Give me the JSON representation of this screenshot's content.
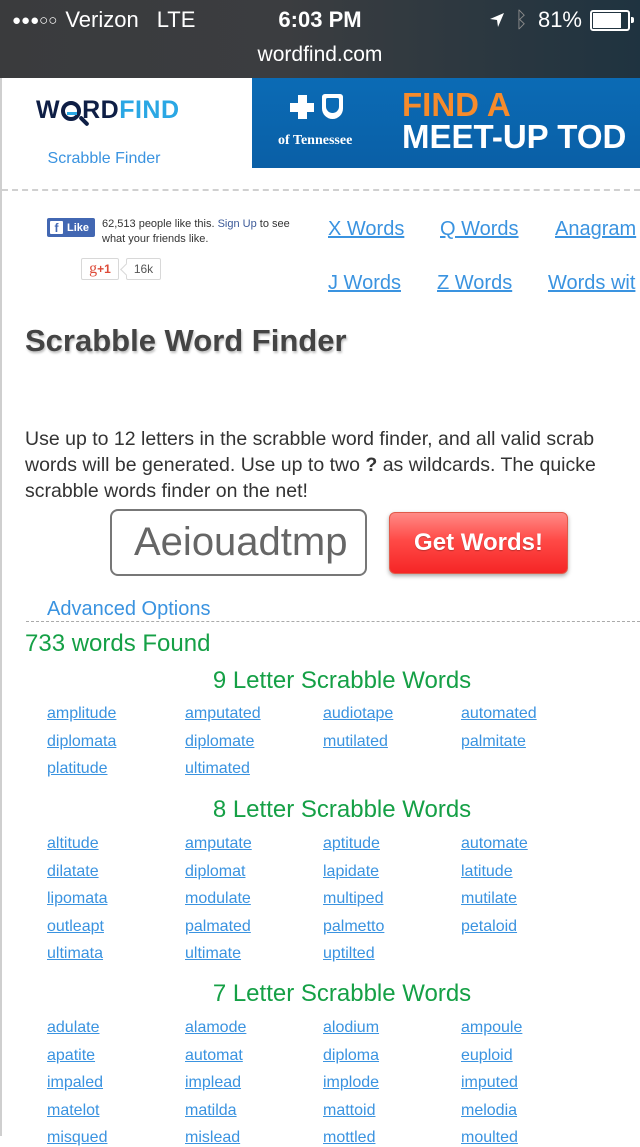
{
  "status_bar": {
    "signal_dots": "●●●○○",
    "carrier": "Verizon",
    "network": "LTE",
    "time": "6:03 PM",
    "battery_percent": "81%",
    "battery_level": 0.81,
    "icons": [
      "location-arrow-icon",
      "bluetooth-icon",
      "battery-icon"
    ]
  },
  "browser": {
    "url": "wordfind.com"
  },
  "header": {
    "logo_dark": "W",
    "logo_dark2": "RD",
    "logo_light": "FIND",
    "tagline": "Scrabble Finder"
  },
  "ad": {
    "sponsor": "of Tennessee",
    "line1": "FIND A",
    "line2": "MEET-UP TOD",
    "colors": {
      "background": "#0b6bb5",
      "accent": "#f68b2b"
    }
  },
  "social": {
    "fb_button": "Like",
    "fb_text_prefix": "62,513 people like this.",
    "fb_signup": "Sign Up",
    "fb_text_suffix": "to see what your friends like.",
    "gplus_label": "+1",
    "gplus_count": "16k"
  },
  "nav_links": [
    {
      "label": "X Words"
    },
    {
      "label": "Q Words"
    },
    {
      "label": "Anagram"
    },
    {
      "label": "J Words"
    },
    {
      "label": "Z Words"
    },
    {
      "label": "Words wit"
    }
  ],
  "main": {
    "title": "Scrabble Word Finder",
    "description_line1": "Use up to 12 letters in the scrabble word finder, and all valid scrab",
    "description_line2_a": "words will be generated. Use up to two",
    "description_wildcard": "?",
    "description_line2_b": "as wildcards. The quicke",
    "description_line3": "scrabble words finder on the net!",
    "letters_value": "Aeiouadtmp",
    "submit_label": "Get Words!",
    "advanced_options": "Advanced Options",
    "found_count": "733 words Found"
  },
  "colors": {
    "link": "#3a93e0",
    "success_green": "#15a046",
    "button_red": "#f52526"
  },
  "results": [
    {
      "title": "9 Letter Scrabble Words",
      "words": [
        "amplitude",
        "amputated",
        "audiotape",
        "automated",
        "diplomata",
        "diplomate",
        "mutilated",
        "palmitate",
        "platitude",
        "ultimated"
      ]
    },
    {
      "title": "8 Letter Scrabble Words",
      "words": [
        "altitude",
        "amputate",
        "aptitude",
        "automate",
        "dilatate",
        "diplomat",
        "lapidate",
        "latitude",
        "lipomata",
        "modulate",
        "multiped",
        "mutilate",
        "outleapt",
        "palmated",
        "palmetto",
        "petaloid",
        "ultimata",
        "ultimate",
        "uptilted"
      ]
    },
    {
      "title": "7 Letter Scrabble Words",
      "words": [
        "adulate",
        "alamode",
        "alodium",
        "ampoule",
        "apatite",
        "automat",
        "diploma",
        "euploid",
        "impaled",
        "implead",
        "implode",
        "imputed",
        "matelot",
        "matilda",
        "mattoid",
        "melodia",
        "misqued",
        "mislead",
        "mottled",
        "moulted"
      ]
    }
  ]
}
